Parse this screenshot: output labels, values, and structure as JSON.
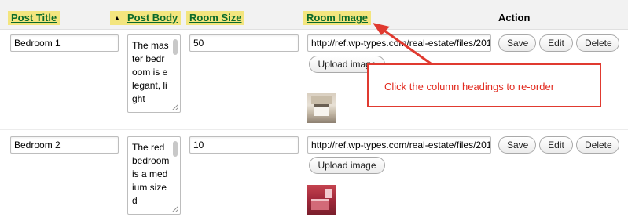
{
  "columns": {
    "post_title": "Post Title",
    "sort_indicator": "▲",
    "post_body": "Post Body",
    "room_size": "Room Size",
    "room_image": "Room Image",
    "action": "Action"
  },
  "rows": [
    {
      "title": "Bedroom 1",
      "body": "The master bedroom is elegant, light",
      "size": "50",
      "image_url": "http://ref.wp-types.com/real-estate/files/201",
      "upload_label": "Upload image",
      "save": "Save",
      "edit": "Edit",
      "delete": "Delete"
    },
    {
      "title": "Bedroom 2",
      "body": "The red bedroom is a medium sized",
      "size": "10",
      "image_url": "http://ref.wp-types.com/real-estate/files/201",
      "upload_label": "Upload image",
      "save": "Save",
      "edit": "Edit",
      "delete": "Delete"
    }
  ],
  "callout": {
    "text": "Click the column headings to re-order",
    "color": "#e22b20"
  },
  "colors": {
    "heading_highlight": "#f3e57e",
    "heading_text": "#0a6a2a",
    "callout_border": "#e03a30"
  }
}
